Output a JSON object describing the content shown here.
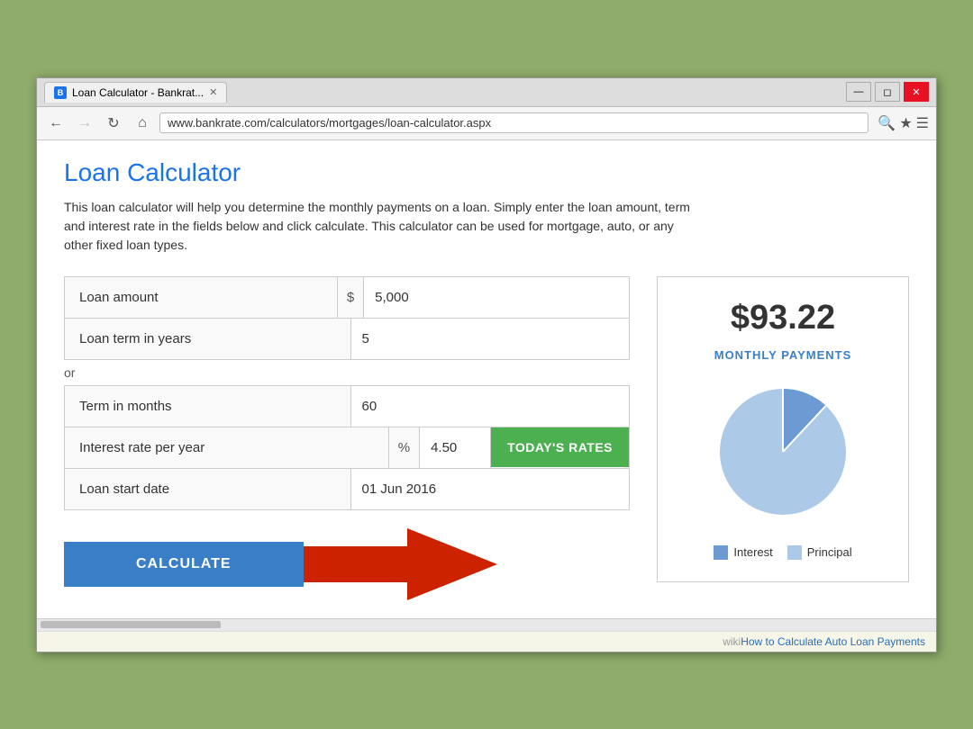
{
  "browser": {
    "tab_favicon": "B",
    "tab_title": "Loan Calculator - Bankrat...",
    "tab_close": "✕",
    "url": "www.bankrate.com/calculators/mortgages/loan-calculator.aspx",
    "win_minimize": "—",
    "win_restore": "◻",
    "win_close": "✕"
  },
  "page": {
    "title": "Loan Calculator",
    "description": "This loan calculator will help you determine the monthly payments on a loan. Simply enter the loan amount, term and interest rate in the fields below and click calculate. This calculator can be used for mortgage, auto, or any other fixed loan types."
  },
  "form": {
    "loan_amount_label": "Loan amount",
    "loan_amount_prefix": "$",
    "loan_amount_value": "5,000",
    "loan_term_label": "Loan term in years",
    "loan_term_value": "5",
    "or_text": "or",
    "term_months_label": "Term in months",
    "term_months_value": "60",
    "interest_label": "Interest rate per year",
    "interest_prefix": "%",
    "interest_value": "4.50",
    "todays_rates_label": "TODAY'S RATES",
    "loan_date_label": "Loan start date",
    "loan_date_value": "01 Jun 2016",
    "calculate_label": "CALCULATE"
  },
  "result": {
    "monthly_amount": "$93.22",
    "monthly_label": "MONTHLY PAYMENTS",
    "legend_interest": "Interest",
    "legend_principal": "Principal"
  },
  "chart": {
    "interest_percent": 12,
    "principal_percent": 88,
    "interest_color": "#6b9bd2",
    "principal_color": "#adc9e8"
  },
  "footer": {
    "wiki_prefix": "wiki",
    "wiki_link_text": "How to Calculate Auto Loan Payments"
  }
}
